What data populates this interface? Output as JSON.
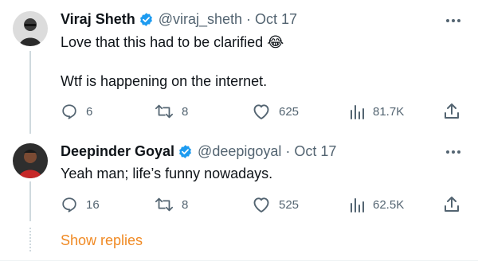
{
  "tweets": [
    {
      "name": "Viraj Sheth",
      "handle": "@viraj_sheth",
      "separator": "·",
      "date": "Oct 17",
      "line1": "Love that this had to be clarified",
      "emoji": "😂",
      "line2": "Wtf is happening on the internet.",
      "replies": "6",
      "retweets": "8",
      "likes": "625",
      "views": "81.7K"
    },
    {
      "name": "Deepinder Goyal",
      "handle": "@deepigoyal",
      "separator": "·",
      "date": "Oct 17",
      "line1": "Yeah man; life’s funny nowadays.",
      "replies": "16",
      "retweets": "8",
      "likes": "525",
      "views": "62.5K"
    }
  ],
  "show_replies": "Show replies",
  "icons": {
    "verified": "verified-badge-icon",
    "reply": "reply-icon",
    "retweet": "retweet-icon",
    "like": "heart-icon",
    "views": "views-icon",
    "share": "share-icon",
    "more": "more-icon"
  },
  "colors": {
    "verified": "#1d9bf0",
    "muted": "#536471",
    "link": "#f08a24"
  }
}
